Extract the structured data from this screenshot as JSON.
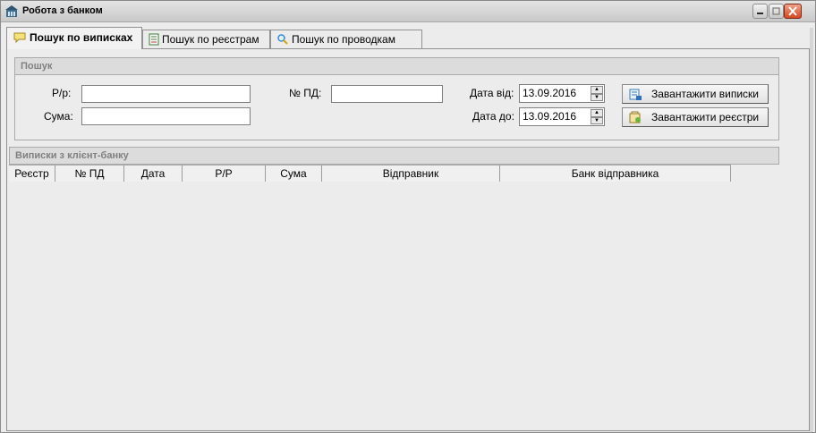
{
  "window": {
    "title": "Робота з банком"
  },
  "tabs": [
    {
      "label": "Пошук по виписках",
      "icon": "chat-bubble-icon",
      "active": true
    },
    {
      "label": "Пошук по реєстрам",
      "icon": "register-list-icon",
      "active": false
    },
    {
      "label": "Пошук по проводкам",
      "icon": "magnifier-icon",
      "active": false
    }
  ],
  "search": {
    "header": "Пошук",
    "rr_label": "Р/р:",
    "rr_value": "",
    "sum_label": "Сума:",
    "sum_value": "",
    "pd_label": "№ ПД:",
    "pd_value": "",
    "date_from_label": "Дата від:",
    "date_from_value": "13.09.2016",
    "date_to_label": "Дата до:",
    "date_to_value": "13.09.2016",
    "load_statements_label": "Завантажити виписки",
    "load_registers_label": "Завантажити реєстри"
  },
  "statements": {
    "header": "Виписки з клієнт-банку",
    "columns": [
      "Реєстр",
      "№ ПД",
      "Дата",
      "Р/Р",
      "Сума",
      "Відправник",
      "Банк відправника"
    ]
  }
}
